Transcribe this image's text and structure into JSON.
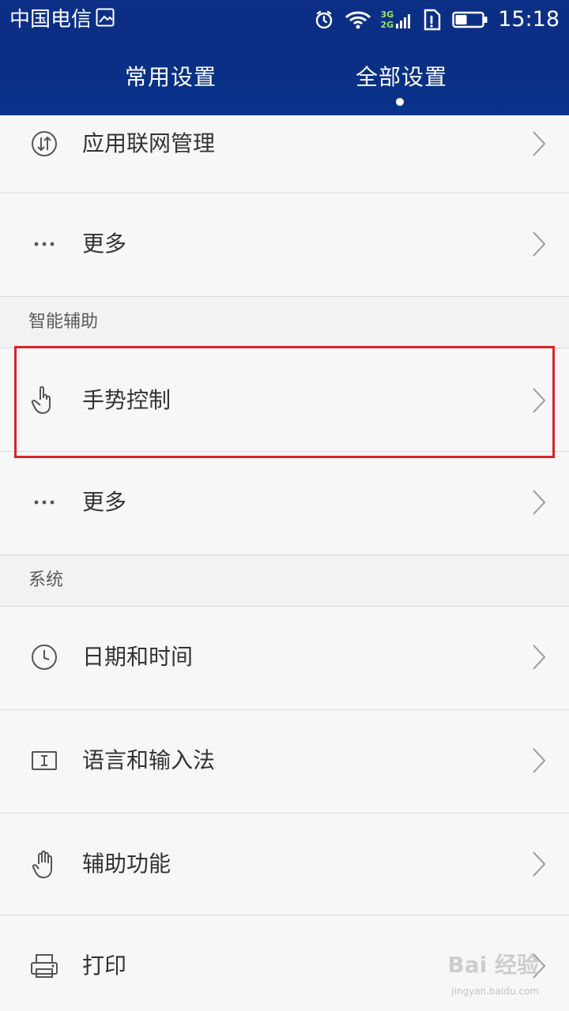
{
  "status_bar": {
    "carrier": "中国电信",
    "network": "3G\n2G",
    "time": "15:18"
  },
  "tabs": [
    {
      "label": "常用设置"
    },
    {
      "label": "全部设置"
    }
  ],
  "list": {
    "rows": [
      {
        "label": "应用联网管理",
        "icon": "network-arrows-icon"
      },
      {
        "label": "更多",
        "icon": "more-dots-icon"
      },
      {
        "label": "手势控制",
        "icon": "gesture-hand-icon"
      },
      {
        "label": "更多",
        "icon": "more-dots-icon"
      },
      {
        "label": "日期和时间",
        "icon": "clock-icon"
      },
      {
        "label": "语言和输入法",
        "icon": "keyboard-input-icon"
      },
      {
        "label": "辅助功能",
        "icon": "hand-icon"
      },
      {
        "label": "打印",
        "icon": "printer-icon"
      }
    ],
    "sections": [
      {
        "label": "智能辅助"
      },
      {
        "label": "系统"
      }
    ]
  },
  "colors": {
    "header_bg": "#0a2f84",
    "highlight_border": "#d8232a"
  },
  "watermark": {
    "brand": "Bai 经验",
    "sub": "jingyan.baidu.com"
  }
}
